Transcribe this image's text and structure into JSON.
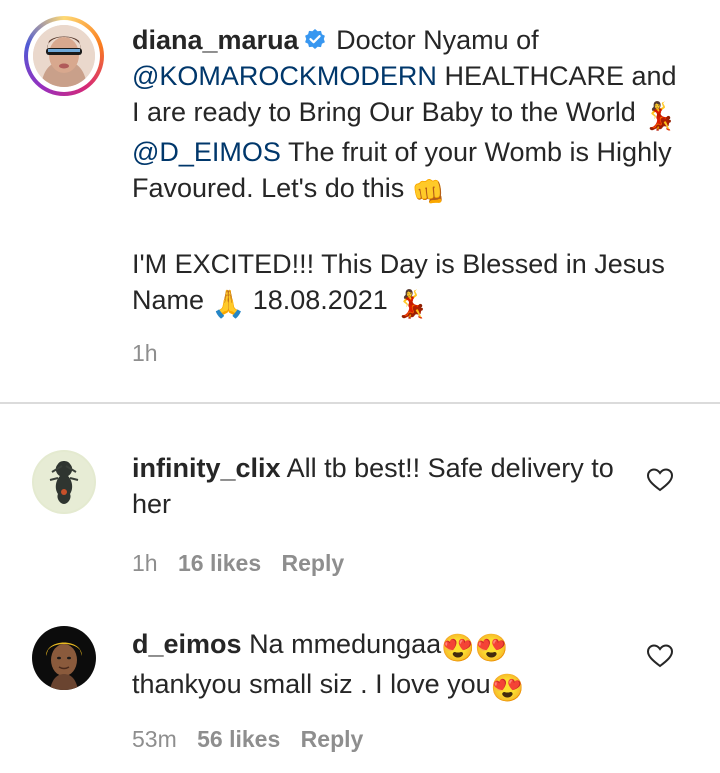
{
  "caption": {
    "username": "diana_marua",
    "text_parts": {
      "p1": "Doctor Nyamu of",
      "mention1": "@KOMAROCKMODERN",
      "p2": "HEALTHCARE and I are ready to Bring Our Baby to the World",
      "mention2": "@D_EIMOS",
      "p3": "The fruit of your Womb is Highly Favoured. Let's do this",
      "p4": "I'M EXCITED!!! This Day is Blessed in Jesus Name",
      "date": "18.08.2021"
    },
    "emojis": {
      "dancer": "💃",
      "fist": "👊",
      "pray": "🙏"
    },
    "time": "1h"
  },
  "comments": [
    {
      "username": "infinity_clix",
      "text": "All tb best!! Safe delivery to her",
      "time": "1h",
      "likes": "16 likes",
      "reply": "Reply"
    },
    {
      "username": "d_eimos",
      "text_before": "Na mmedungaa",
      "text_middle": "thankyou small siz . I love you",
      "emoji": "😍",
      "time": "53m",
      "likes": "56 likes",
      "reply": "Reply"
    }
  ],
  "colors": {
    "text": "#262626",
    "secondary": "#8e8e8e",
    "mention": "#00376b",
    "verified": "#3897f0",
    "divider": "#dbdbdb"
  },
  "icons": {
    "verified": "verified-badge-icon",
    "like": "heart-outline-icon"
  }
}
